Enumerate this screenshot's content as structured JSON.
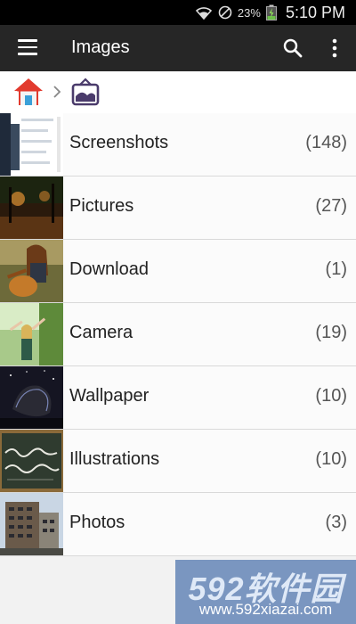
{
  "status_bar": {
    "battery_percent": "23%",
    "time": "5:10 PM"
  },
  "app_bar": {
    "title": "Images",
    "menu_icon": "hamburger-menu-icon",
    "search_icon": "search-icon",
    "more_icon": "more-vert-icon"
  },
  "breadcrumb": {
    "items": [
      {
        "icon": "home-icon"
      },
      {
        "icon": "images-folder-icon"
      }
    ]
  },
  "folders": [
    {
      "name": "Screenshots",
      "count": "(148)",
      "thumb_color": "#20242c"
    },
    {
      "name": "Pictures",
      "count": "(27)",
      "thumb_color": "#3a2410"
    },
    {
      "name": "Download",
      "count": "(1)",
      "thumb_color": "#7a5a2a"
    },
    {
      "name": "Camera",
      "count": "(19)",
      "thumb_color": "#8fb36a"
    },
    {
      "name": "Wallpaper",
      "count": "(10)",
      "thumb_color": "#1c1c28"
    },
    {
      "name": "Illustrations",
      "count": "(10)",
      "thumb_color": "#2c3a2c"
    },
    {
      "name": "Photos",
      "count": "(3)",
      "thumb_color": "#b9c6d4"
    }
  ],
  "watermark": {
    "logo": "592软件园",
    "url": "www.592xiazai.com"
  }
}
